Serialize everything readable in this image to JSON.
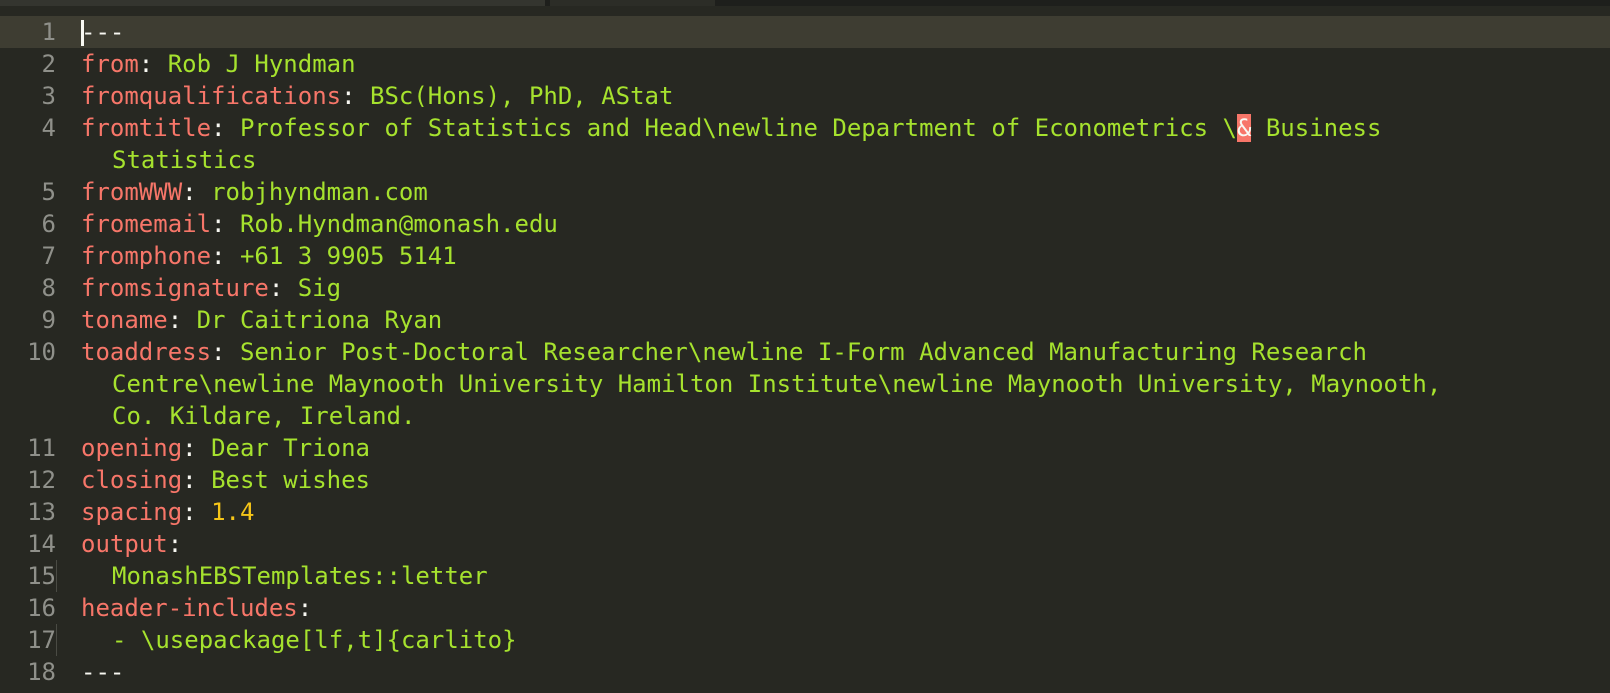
{
  "editor": {
    "lines": [
      {
        "num": "1",
        "text": "---"
      },
      {
        "num": "2",
        "key": "from",
        "value": "Rob J Hyndman"
      },
      {
        "num": "3",
        "key": "fromqualifications",
        "value": "BSc(Hons), PhD, AStat"
      },
      {
        "num": "4",
        "key": "fromtitle",
        "value_a": "Professor of Statistics and Head\\newline Department of Econometrics \\",
        "value_amp": "&",
        "value_b": " Business",
        "value_wrap": "Statistics"
      },
      {
        "num": "5",
        "key": "fromWWW",
        "value": "robjhyndman.com"
      },
      {
        "num": "6",
        "key": "fromemail",
        "value": "Rob.Hyndman@monash.edu"
      },
      {
        "num": "7",
        "key": "fromphone",
        "value": "+61 3 9905 5141"
      },
      {
        "num": "8",
        "key": "fromsignature",
        "value": "Sig"
      },
      {
        "num": "9",
        "key": "toname",
        "value": "Dr Caitriona Ryan"
      },
      {
        "num": "10",
        "key": "toaddress",
        "value": "Senior Post-Doctoral Researcher\\newline I-Form Advanced Manufacturing Research",
        "value_wrap1": "Centre\\newline Maynooth University Hamilton Institute\\newline Maynooth University, Maynooth,",
        "value_wrap2": "Co. Kildare, Ireland."
      },
      {
        "num": "11",
        "key": "opening",
        "value": "Dear Triona"
      },
      {
        "num": "12",
        "key": "closing",
        "value": "Best wishes"
      },
      {
        "num": "13",
        "key": "spacing",
        "value": "1.4"
      },
      {
        "num": "14",
        "key": "output",
        "value": ""
      },
      {
        "num": "15",
        "value": "MonashEBSTemplates::letter"
      },
      {
        "num": "16",
        "key": "header-includes",
        "value": ""
      },
      {
        "num": "17",
        "value": "- \\usepackage[lf,t]{carlito}"
      },
      {
        "num": "18",
        "text": "---"
      }
    ]
  }
}
